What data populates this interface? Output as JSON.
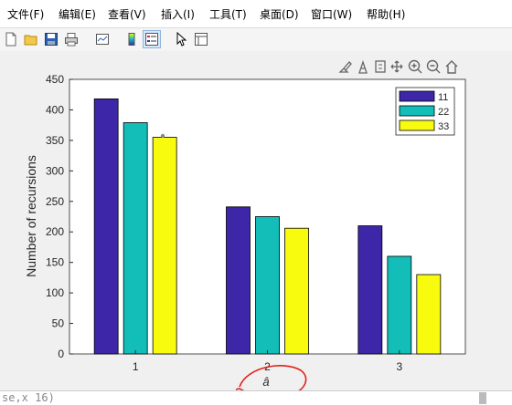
{
  "menu": [
    "文件(F)",
    "编辑(E)",
    "查看(V)",
    "插入(I)",
    "工具(T)",
    "桌面(D)",
    "窗口(W)",
    "帮助(H)"
  ],
  "toolbar_icons": [
    "new-file-icon",
    "open-folder-icon",
    "save-icon",
    "print-icon",
    "link-plot-icon",
    "colorbar-icon",
    "legend-icon",
    "pointer-icon",
    "property-editor-icon"
  ],
  "axes_toolbar_icons": [
    "brush-icon",
    "data-cursor-icon",
    "rotate-icon",
    "pan-icon",
    "zoom-in-icon",
    "zoom-out-icon",
    "home-icon"
  ],
  "chart_data": {
    "type": "bar",
    "categories": [
      "1",
      "2",
      "3"
    ],
    "series": [
      {
        "name": "11",
        "color": "#3e26a8",
        "values": [
          418,
          241,
          210
        ]
      },
      {
        "name": "22",
        "color": "#13beb8",
        "values": [
          379,
          225,
          160
        ]
      },
      {
        "name": "33",
        "color": "#f9fb0e",
        "values": [
          355,
          206,
          130
        ]
      }
    ],
    "ylabel": "Number of recursions",
    "xlabel": "â",
    "ylim": [
      0,
      450
    ],
    "yticks": [
      "0",
      "50",
      "100",
      "150",
      "200",
      "250",
      "300",
      "350",
      "400",
      "450"
    ],
    "legend_position": "top-right",
    "grid": false
  },
  "annotation_color": "#e0201b",
  "command_fragment": "se,x  16)"
}
